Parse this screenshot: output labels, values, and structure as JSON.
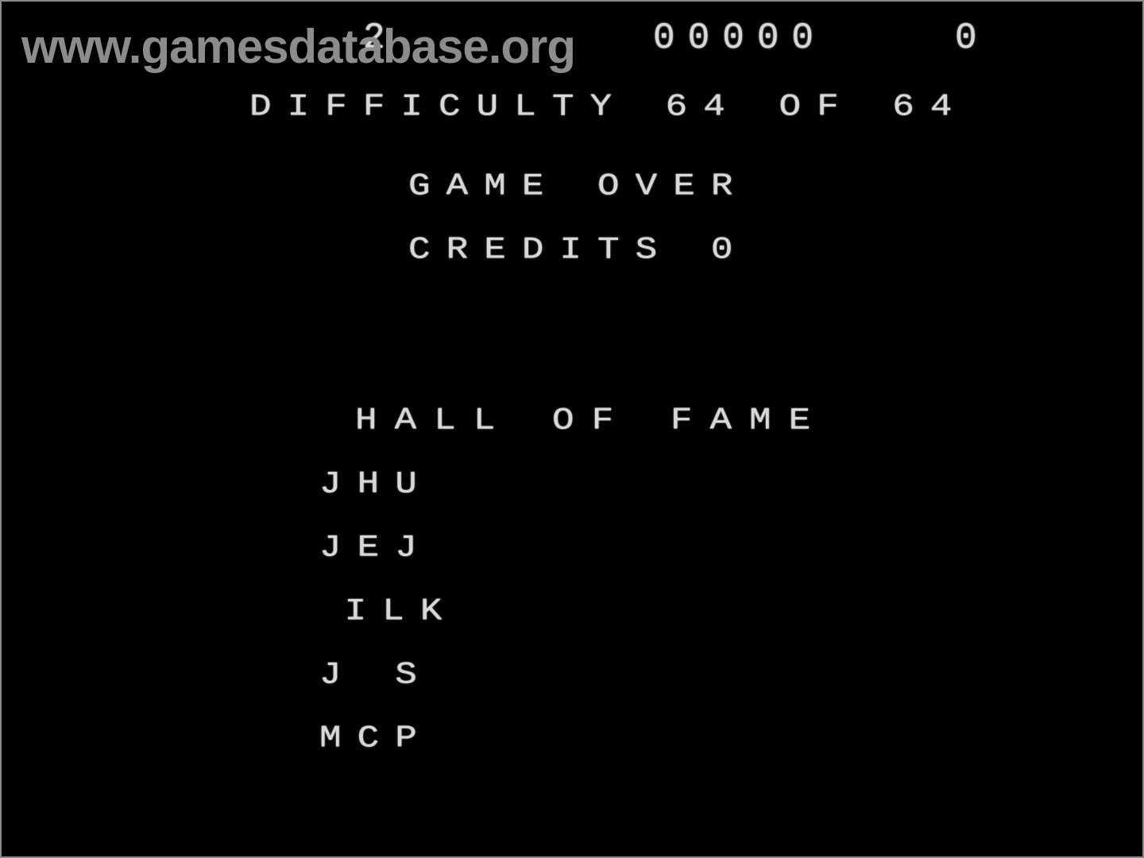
{
  "watermark": "www.gamesdatabase.org",
  "hud": {
    "player_indicator": "2",
    "score": "00000",
    "right_value": "0"
  },
  "difficulty": {
    "label": "DIFFICULTY 64 OF 64",
    "current": 64,
    "max": 64
  },
  "status": "GAME OVER",
  "credits": "CREDITS 0",
  "hall_of_fame": {
    "title": "HALL OF FAME",
    "entries": [
      "JHU",
      "JEJ",
      " ILK",
      "J S",
      "MCP"
    ]
  },
  "colors": {
    "background": "#000000",
    "vector_text": "#d8d8d8",
    "watermark": "#8c8c8c"
  }
}
